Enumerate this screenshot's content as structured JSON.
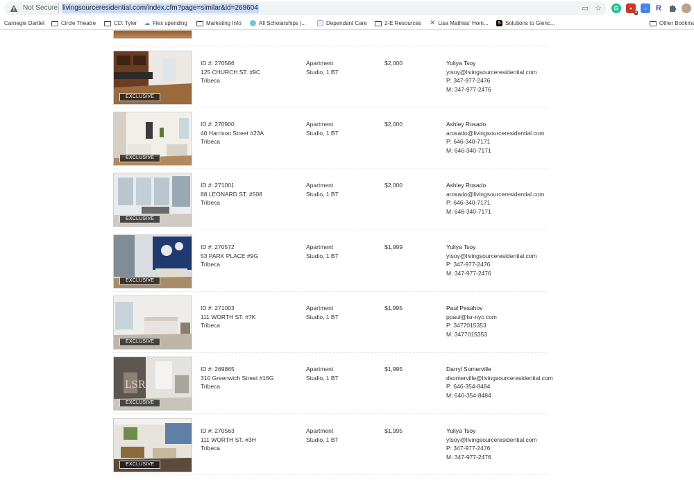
{
  "browser": {
    "not_secure_label": "Not Secure",
    "url": "livingsourceresidential.com/index.cfm?page=similar&id=268604",
    "icons": [
      "warning-icon",
      "cast-icon",
      "star-icon",
      "grammarly-icon",
      "extension-red-icon",
      "extension-blue-icon",
      "extension-r-icon",
      "puzzle-icon",
      "profile-avatar"
    ],
    "badge_count": "1",
    "ext_r_label": "R"
  },
  "bookmarks": [
    {
      "label": "Carnegie Dartlet",
      "icon": "none"
    },
    {
      "label": "Circle Theatre",
      "icon": "folder-icon"
    },
    {
      "label": "CD: Tyler",
      "icon": "folder-icon"
    },
    {
      "label": "Flex spending",
      "icon": "cloud-icon"
    },
    {
      "label": "Marketing Info",
      "icon": "folder-icon"
    },
    {
      "label": "All Scholarships |...",
      "icon": "globe-icon"
    },
    {
      "label": "Dependant Care",
      "icon": "doc-icon"
    },
    {
      "label": "2-E Resources",
      "icon": "folder-icon"
    },
    {
      "label": "Lisa Mathias' Hom...",
      "icon": "x-icon"
    },
    {
      "label": "Solutions to Glenc...",
      "icon": "s-icon"
    },
    {
      "label": "Other Bookmarks",
      "icon": "folder-icon"
    }
  ],
  "badge_label": "EXCLUSIVE",
  "listings": [
    {
      "id": "ID #: 270586",
      "address": "125 CHURCH ST. #9C",
      "neighborhood": "Tribeca",
      "type": "Apartment",
      "size": "Studio, 1 BT",
      "price": "$2,000",
      "agent": "Yuliya Tsoy",
      "email": "ytsoy@livingsourceresidential.com",
      "phone": "P: 347-977-2476",
      "mobile": "M: 347-977-2476"
    },
    {
      "id": "ID #: 270900",
      "address": "40 Harrison Street #23A",
      "neighborhood": "Tribeca",
      "type": "Apartment",
      "size": "Studio, 1 BT",
      "price": "$2,000",
      "agent": "Ashley Rosado",
      "email": "arosado@livingsourceresidential.com",
      "phone": "P: 646-340-7171",
      "mobile": "M: 646-340-7171"
    },
    {
      "id": "ID #: 271001",
      "address": "88 LEONARD ST. #508",
      "neighborhood": "Tribeca",
      "type": "Apartment",
      "size": "Studio, 1 BT",
      "price": "$2,000",
      "agent": "Ashley Rosado",
      "email": "arosado@livingsourceresidential.com",
      "phone": "P: 646-340-7171",
      "mobile": "M: 646-340-7171"
    },
    {
      "id": "ID #: 270572",
      "address": "53 PARK PLACE #9G",
      "neighborhood": "Tribeca",
      "type": "Apartment",
      "size": "Studio, 1 BT",
      "price": "$1,999",
      "agent": "Yuliya Tsoy",
      "email": "ytsoy@livingsourceresidential.com",
      "phone": "P: 347-977-2476",
      "mobile": "M: 347-977-2476"
    },
    {
      "id": "ID #: 271003",
      "address": "111 WORTH ST. #7K",
      "neighborhood": "Tribeca",
      "type": "Apartment",
      "size": "Studio, 1 BT",
      "price": "$1,995",
      "agent": "Paul Pesahov",
      "email": "ppaul@lsr-nyc.com",
      "phone": "P: 3477015353",
      "mobile": "M: 3477015353"
    },
    {
      "id": "ID #: 269865",
      "address": "310 Greenwich Street #16G",
      "neighborhood": "Tribeca",
      "type": "Apartment",
      "size": "Studio, 1 BT",
      "price": "$1,995",
      "agent": "Darryl Somerville",
      "email": "dsomerville@livingsourceresidential.com",
      "phone": "P: 646-354-8484",
      "mobile": "M: 646-354-8484"
    },
    {
      "id": "ID #: 270563",
      "address": "111 WORTH ST. #3H",
      "neighborhood": "Tribeca",
      "type": "Apartment",
      "size": "Studio, 1 BT",
      "price": "$1,995",
      "agent": "Yuliya Tsoy",
      "email": "ytsoy@livingsourceresidential.com",
      "phone": "P: 347-977-2476",
      "mobile": "M: 347-977-2476"
    }
  ],
  "colors": {
    "omnibox_bg": "#f1f3f4",
    "url_highlight": "#c8dcf8",
    "text": "#333333",
    "badge_bg": "#141414"
  }
}
